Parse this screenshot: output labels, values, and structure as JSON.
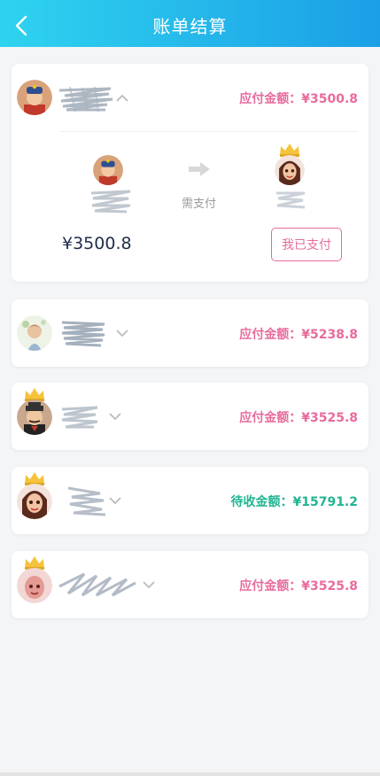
{
  "header": {
    "title": "账单结算",
    "back_icon": "chevron-left-icon"
  },
  "colors": {
    "header_start": "#2fd3ef",
    "header_end": "#1b9fe6",
    "pink": "#e86b9d",
    "teal": "#22b593"
  },
  "cards": [
    {
      "amount_label": "应付金额：¥3500.8",
      "expanded": true,
      "detail": {
        "need_pay_label": "需支付",
        "amount": "¥3500.8",
        "paid_button": "我已支付"
      }
    },
    {
      "amount_label": "应付金额：¥5238.8",
      "expanded": false
    },
    {
      "amount_label": "应付金额：¥3525.8",
      "expanded": false
    },
    {
      "amount_label": "待收金额：¥15791.2",
      "expanded": false
    },
    {
      "amount_label": "应付金额：¥3525.8",
      "expanded": false
    }
  ]
}
